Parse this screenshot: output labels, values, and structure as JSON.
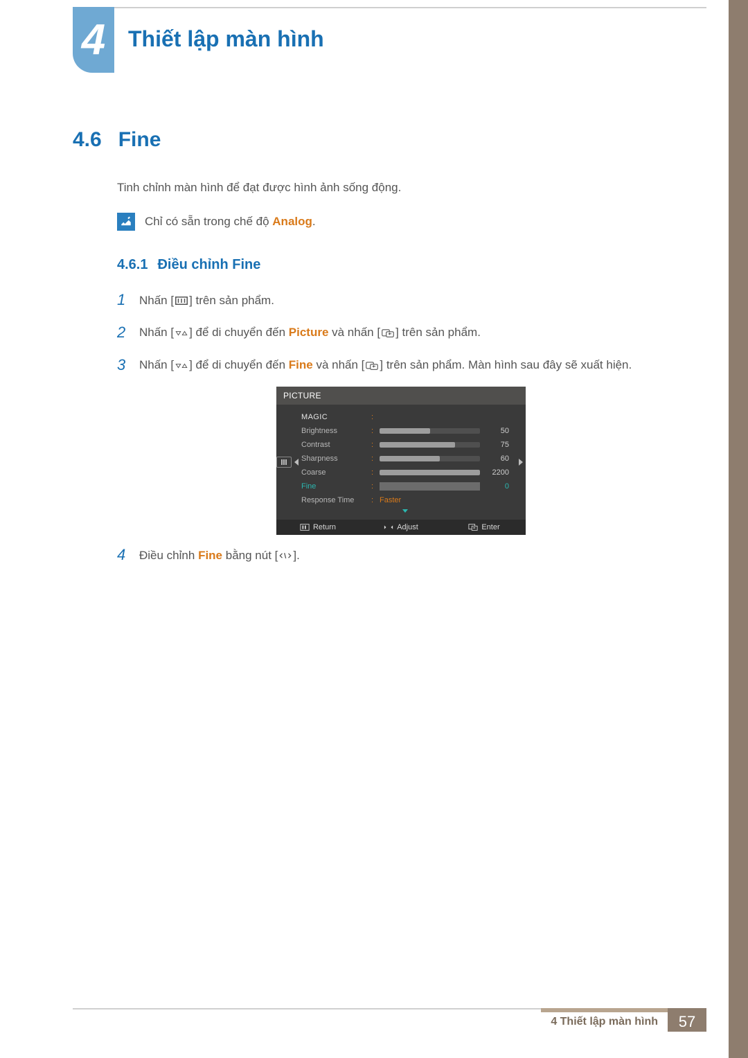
{
  "chapter": {
    "number": "4",
    "title": "Thiết lập màn hình"
  },
  "section": {
    "number": "4.6",
    "title": "Fine"
  },
  "intro": "Tinh chỉnh màn hình để đạt được hình ảnh sống động.",
  "note": {
    "pre": "Chỉ có sẵn trong chế độ ",
    "em": "Analog",
    "post": "."
  },
  "subsection": {
    "number": "4.6.1",
    "title": "Điều chỉnh Fine"
  },
  "steps": {
    "s1": {
      "num": "1",
      "t1": "Nhấn [",
      "t2": "] trên sản phẩm."
    },
    "s2": {
      "num": "2",
      "t1": "Nhấn [",
      "t2": "] để di chuyển đến ",
      "em": "Picture",
      "t3": " và nhấn [",
      "t4": "] trên sản phẩm."
    },
    "s3": {
      "num": "3",
      "t1": "Nhấn [",
      "t2": "] để di chuyển đến ",
      "em": "Fine",
      "t3": " và nhấn [",
      "t4": "] trên sản phẩm. Màn hình sau đây sẽ xuất hiện."
    },
    "s4": {
      "num": "4",
      "t1": "Điều chỉnh ",
      "em": "Fine",
      "t2": " bằng nút [",
      "t3": "]."
    }
  },
  "osd": {
    "header": "PICTURE",
    "rows": {
      "magic": "MAGIC",
      "brightness": {
        "label": "Brightness",
        "value": "50",
        "pct": 50
      },
      "contrast": {
        "label": "Contrast",
        "value": "75",
        "pct": 75
      },
      "sharpness": {
        "label": "Sharpness",
        "value": "60",
        "pct": 60
      },
      "coarse": {
        "label": "Coarse",
        "value": "2200",
        "pct": 100
      },
      "fine": {
        "label": "Fine",
        "value": "0"
      },
      "response": {
        "label": "Response Time",
        "value": "Faster"
      }
    },
    "footer": {
      "return": "Return",
      "adjust": "Adjust",
      "enter": "Enter"
    }
  },
  "footer": {
    "label": "4 Thiết lập màn hình",
    "page": "57"
  }
}
